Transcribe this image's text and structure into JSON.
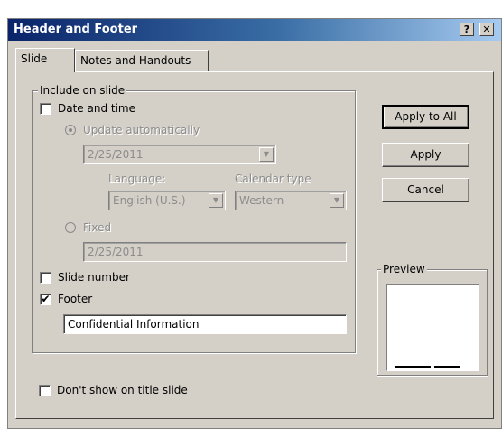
{
  "window": {
    "title": "Header and Footer",
    "help_button": "?",
    "close_button": "✕"
  },
  "tabs": [
    {
      "label": "Slide",
      "active": true
    },
    {
      "label": "Notes and Handouts",
      "active": false
    }
  ],
  "include_group": {
    "legend": "Include on slide",
    "date_time": {
      "label": "Date and time",
      "checked": false
    },
    "update_auto": {
      "label": "Update automatically",
      "selected": true,
      "value": "2/25/2011"
    },
    "language": {
      "label": "Language:",
      "value": "English (U.S.)"
    },
    "calendar": {
      "label": "Calendar type",
      "value": "Western"
    },
    "fixed": {
      "label": "Fixed",
      "selected": false,
      "value": "2/25/2011"
    },
    "slide_number": {
      "label": "Slide number",
      "checked": false
    },
    "footer": {
      "label": "Footer",
      "checked": true,
      "value": "Confidential Information"
    }
  },
  "dont_show": {
    "label": "Don't show on title slide",
    "checked": false
  },
  "buttons": {
    "apply_all": "Apply to All",
    "apply": "Apply",
    "cancel": "Cancel"
  },
  "preview": {
    "legend": "Preview"
  },
  "check_mark": "✔"
}
